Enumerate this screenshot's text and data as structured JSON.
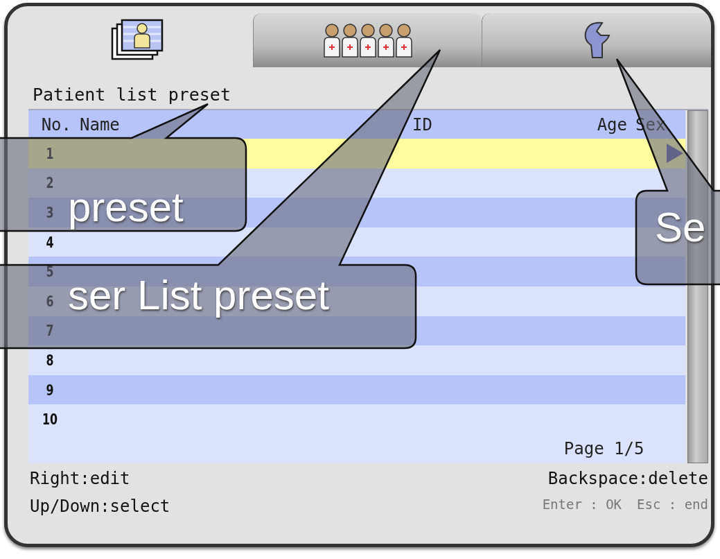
{
  "tabs": [
    {
      "kind": "patient-card",
      "selected": true
    },
    {
      "kind": "patients",
      "selected": false
    },
    {
      "kind": "wrench",
      "selected": false
    }
  ],
  "title": "Patient list preset",
  "table": {
    "columns": {
      "no": "No.",
      "name": "Name",
      "id": "ID",
      "age": "Age",
      "sex": "Sex"
    },
    "rows": [
      {
        "no": "1",
        "selected": true
      },
      {
        "no": "2",
        "selected": false
      },
      {
        "no": "3",
        "selected": false
      },
      {
        "no": "4",
        "selected": false
      },
      {
        "no": "5",
        "selected": false
      },
      {
        "no": "6",
        "selected": false
      },
      {
        "no": "7",
        "selected": false
      },
      {
        "no": "8",
        "selected": false
      },
      {
        "no": "9",
        "selected": false
      },
      {
        "no": "10",
        "selected": false
      }
    ],
    "page": "Page 1/5"
  },
  "hints": {
    "left": [
      "Right:edit",
      "Up/Down:select"
    ],
    "right": "Backspace:delete",
    "keys": [
      "Enter : OK",
      "Esc : end"
    ]
  },
  "callouts": [
    {
      "text": "preset"
    },
    {
      "text": "ser List preset"
    },
    {
      "text": "Se"
    }
  ]
}
